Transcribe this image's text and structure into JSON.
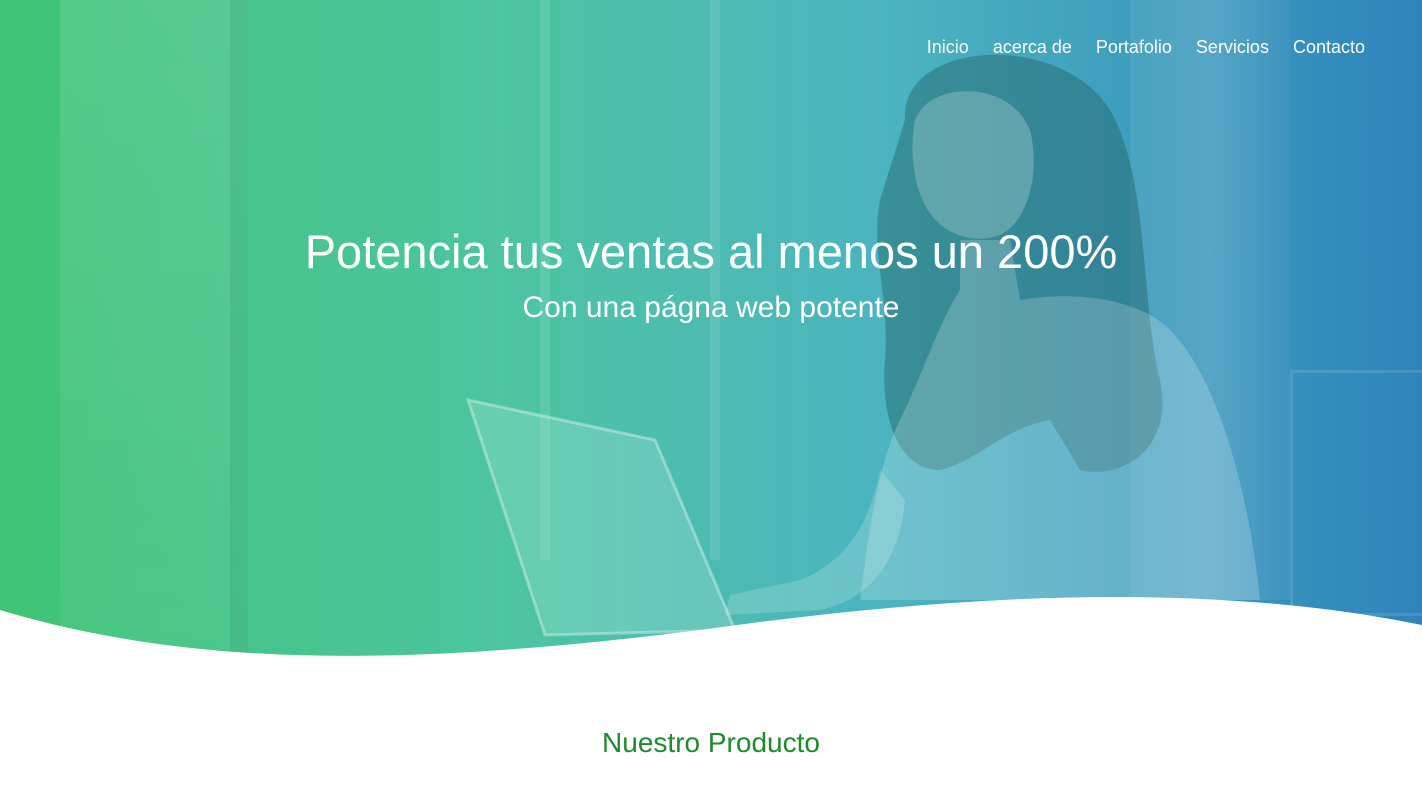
{
  "nav": {
    "items": [
      {
        "label": "Inicio"
      },
      {
        "label": "acerca de"
      },
      {
        "label": "Portafolio"
      },
      {
        "label": "Servicios"
      },
      {
        "label": "Contacto"
      }
    ]
  },
  "hero": {
    "title": "Potencia tus ventas al menos un 200%",
    "subtitle": "Con una págna web potente",
    "background_image": "woman-with-laptop-photo"
  },
  "product_section": {
    "title": "Nuestro Producto"
  },
  "colors": {
    "gradient_start": "#3fc475",
    "gradient_mid": "#4cc5a0",
    "gradient_end": "#2f84bb",
    "section_title": "#1d8a2e",
    "background": "#ffffff"
  }
}
